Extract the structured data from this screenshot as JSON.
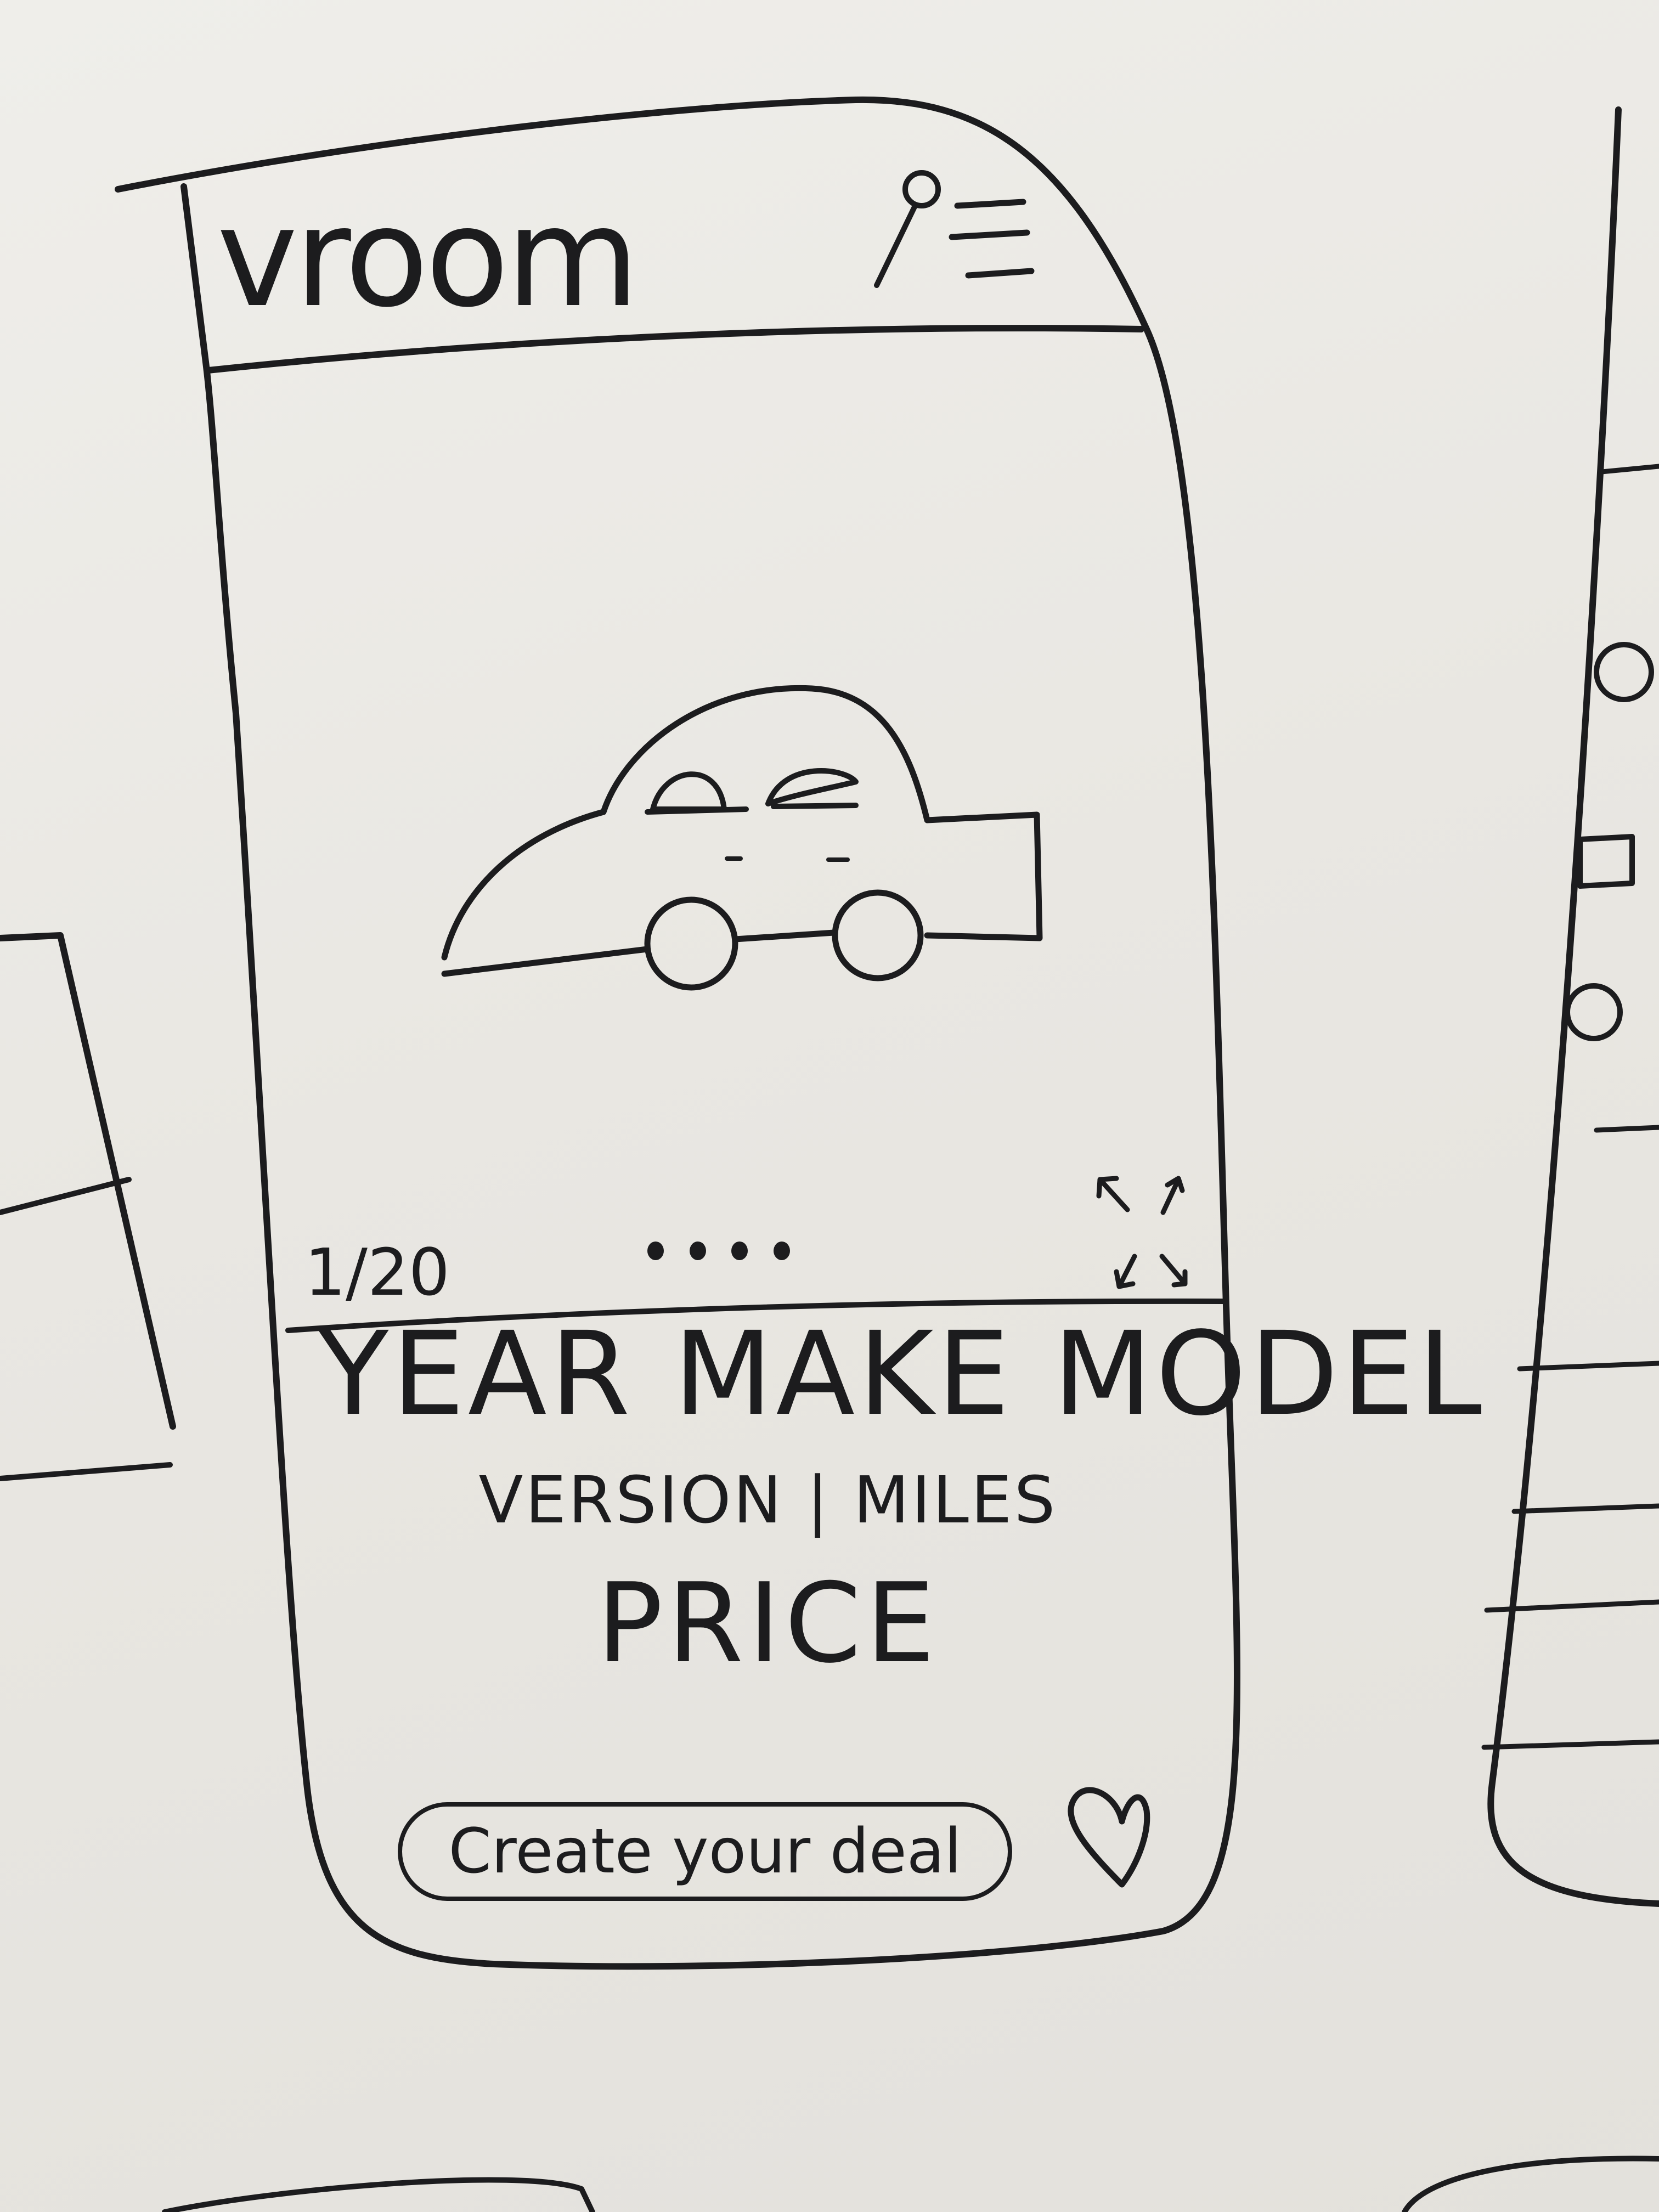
{
  "header": {
    "title": "vroom",
    "pin_icon": "location-pin-icon",
    "menu_icon": "hamburger-menu-icon"
  },
  "gallery": {
    "image_icon": "car-icon",
    "counter": "1/20",
    "current_index": 1,
    "total": 20,
    "dots_count": 4,
    "expand_icon": "expand-arrows-icon"
  },
  "listing": {
    "headline": "YEAR MAKE MODEL",
    "subline": "VERSION | MILES",
    "price": "PRICE"
  },
  "actions": {
    "deal_button_label": "Create your deal",
    "favorite_icon": "heart-icon"
  },
  "colors": {
    "ink": "#1c1c1e",
    "paper": "#eae8e3"
  }
}
